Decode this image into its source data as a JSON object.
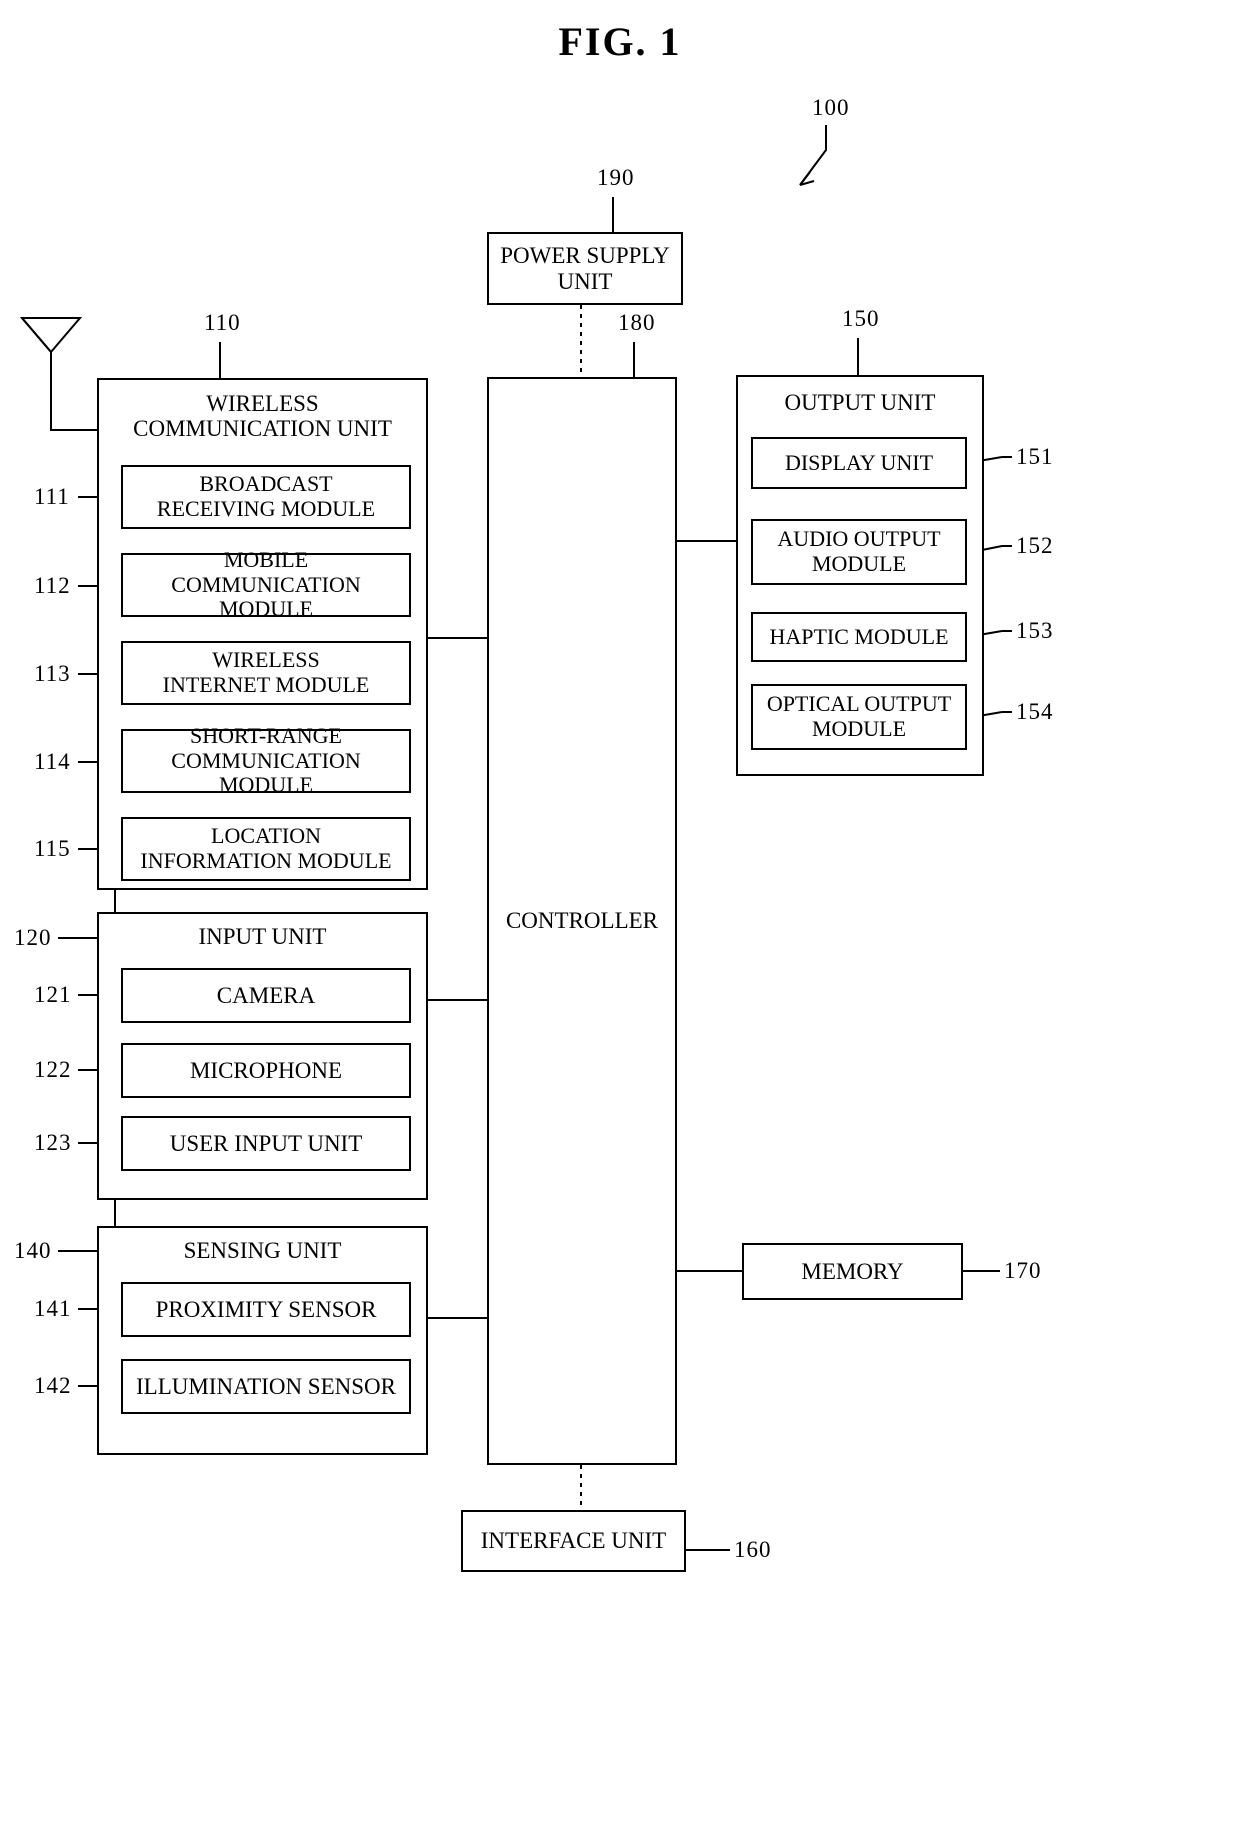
{
  "figure": {
    "title": "FIG. 1",
    "device_ref": "100"
  },
  "blocks": {
    "power_supply": {
      "label": "POWER SUPPLY\nUNIT",
      "ref": "190"
    },
    "controller": {
      "label": "CONTROLLER",
      "ref": "180"
    },
    "memory": {
      "label": "MEMORY",
      "ref": "170"
    },
    "interface": {
      "label": "INTERFACE UNIT",
      "ref": "160"
    },
    "wireless_communication_unit": {
      "label": "WIRELESS\nCOMMUNICATION UNIT",
      "ref": "110",
      "modules": [
        {
          "label": "BROADCAST\nRECEIVING MODULE",
          "ref": "111"
        },
        {
          "label": "MOBILE\nCOMMUNICATION MODULE",
          "ref": "112"
        },
        {
          "label": "WIRELESS\nINTERNET MODULE",
          "ref": "113"
        },
        {
          "label": "SHORT-RANGE\nCOMMUNICATION MODULE",
          "ref": "114"
        },
        {
          "label": "LOCATION\nINFORMATION MODULE",
          "ref": "115"
        }
      ]
    },
    "input_unit": {
      "label": "INPUT UNIT",
      "ref": "120",
      "modules": [
        {
          "label": "CAMERA",
          "ref": "121"
        },
        {
          "label": "MICROPHONE",
          "ref": "122"
        },
        {
          "label": "USER INPUT UNIT",
          "ref": "123"
        }
      ]
    },
    "sensing_unit": {
      "label": "SENSING UNIT",
      "ref": "140",
      "modules": [
        {
          "label": "PROXIMITY SENSOR",
          "ref": "141"
        },
        {
          "label": "ILLUMINATION SENSOR",
          "ref": "142"
        }
      ]
    },
    "output_unit": {
      "label": "OUTPUT UNIT",
      "ref": "150",
      "modules": [
        {
          "label": "DISPLAY UNIT",
          "ref": "151"
        },
        {
          "label": "AUDIO OUTPUT\nMODULE",
          "ref": "152"
        },
        {
          "label": "HAPTIC MODULE",
          "ref": "153"
        },
        {
          "label": "OPTICAL OUTPUT\nMODULE",
          "ref": "154"
        }
      ]
    }
  },
  "icons": {
    "antenna": "antenna-icon"
  },
  "colors": {
    "line": "#000000",
    "background": "#ffffff"
  }
}
